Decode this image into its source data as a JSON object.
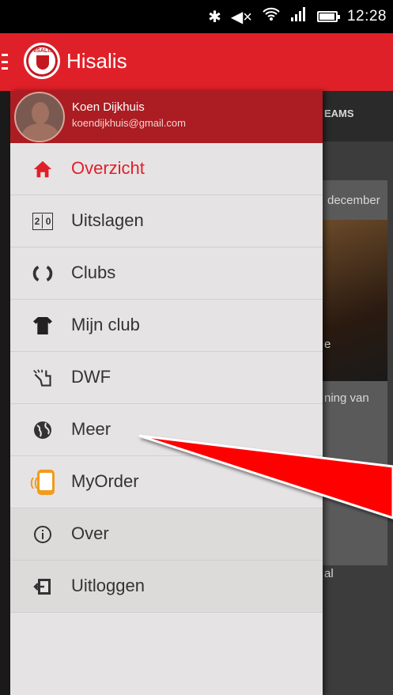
{
  "status_bar": {
    "time": "12:28",
    "icons": [
      "bluetooth-icon",
      "volume-muted-icon",
      "wifi-icon",
      "signal-icon",
      "battery-icon"
    ],
    "battery_level": 0.85
  },
  "app_bar": {
    "title": "Hisalis",
    "logo_text": "HISALIS",
    "color": "#e02028"
  },
  "profile": {
    "name": "Koen Dijkhuis",
    "email": "koendijkhuis@gmail.com"
  },
  "menu": [
    {
      "label": "Overzicht",
      "icon": "home-icon",
      "active": true
    },
    {
      "label": "Uitslagen",
      "icon": "scoreboard-icon",
      "active": false
    },
    {
      "label": "Clubs",
      "icon": "laurel-icon",
      "active": false
    },
    {
      "label": "Mijn club",
      "icon": "shirt-icon",
      "active": false
    },
    {
      "label": "DWF",
      "icon": "whistle-icon",
      "active": false
    },
    {
      "label": "Meer",
      "icon": "globe-icon",
      "active": false
    },
    {
      "label": "MyOrder",
      "icon": "myorder-icon",
      "active": false
    },
    {
      "label": "Over",
      "icon": "info-icon",
      "active": false
    },
    {
      "label": "Uitloggen",
      "icon": "logout-icon",
      "active": false
    }
  ],
  "background": {
    "tab_label": "EAMS",
    "date_text": "december",
    "card_text_1": "e",
    "card_text_2": "ning van",
    "card_text_3": "al"
  },
  "calendar_digits": [
    "2",
    "0"
  ]
}
